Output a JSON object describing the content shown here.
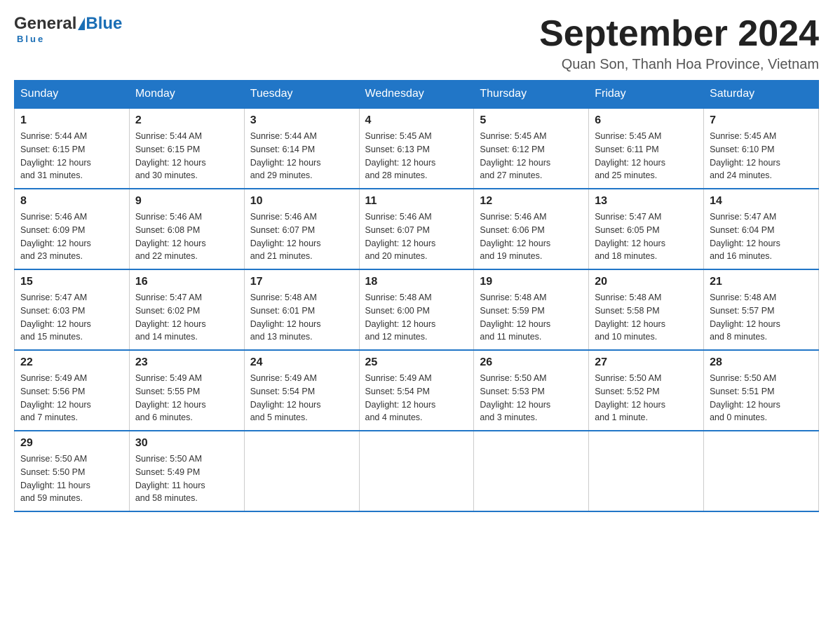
{
  "logo": {
    "general": "General",
    "blue": "Blue"
  },
  "title": "September 2024",
  "location": "Quan Son, Thanh Hoa Province, Vietnam",
  "days_of_week": [
    "Sunday",
    "Monday",
    "Tuesday",
    "Wednesday",
    "Thursday",
    "Friday",
    "Saturday"
  ],
  "weeks": [
    [
      {
        "day": "1",
        "sunrise": "5:44 AM",
        "sunset": "6:15 PM",
        "daylight": "12 hours and 31 minutes."
      },
      {
        "day": "2",
        "sunrise": "5:44 AM",
        "sunset": "6:15 PM",
        "daylight": "12 hours and 30 minutes."
      },
      {
        "day": "3",
        "sunrise": "5:44 AM",
        "sunset": "6:14 PM",
        "daylight": "12 hours and 29 minutes."
      },
      {
        "day": "4",
        "sunrise": "5:45 AM",
        "sunset": "6:13 PM",
        "daylight": "12 hours and 28 minutes."
      },
      {
        "day": "5",
        "sunrise": "5:45 AM",
        "sunset": "6:12 PM",
        "daylight": "12 hours and 27 minutes."
      },
      {
        "day": "6",
        "sunrise": "5:45 AM",
        "sunset": "6:11 PM",
        "daylight": "12 hours and 25 minutes."
      },
      {
        "day": "7",
        "sunrise": "5:45 AM",
        "sunset": "6:10 PM",
        "daylight": "12 hours and 24 minutes."
      }
    ],
    [
      {
        "day": "8",
        "sunrise": "5:46 AM",
        "sunset": "6:09 PM",
        "daylight": "12 hours and 23 minutes."
      },
      {
        "day": "9",
        "sunrise": "5:46 AM",
        "sunset": "6:08 PM",
        "daylight": "12 hours and 22 minutes."
      },
      {
        "day": "10",
        "sunrise": "5:46 AM",
        "sunset": "6:07 PM",
        "daylight": "12 hours and 21 minutes."
      },
      {
        "day": "11",
        "sunrise": "5:46 AM",
        "sunset": "6:07 PM",
        "daylight": "12 hours and 20 minutes."
      },
      {
        "day": "12",
        "sunrise": "5:46 AM",
        "sunset": "6:06 PM",
        "daylight": "12 hours and 19 minutes."
      },
      {
        "day": "13",
        "sunrise": "5:47 AM",
        "sunset": "6:05 PM",
        "daylight": "12 hours and 18 minutes."
      },
      {
        "day": "14",
        "sunrise": "5:47 AM",
        "sunset": "6:04 PM",
        "daylight": "12 hours and 16 minutes."
      }
    ],
    [
      {
        "day": "15",
        "sunrise": "5:47 AM",
        "sunset": "6:03 PM",
        "daylight": "12 hours and 15 minutes."
      },
      {
        "day": "16",
        "sunrise": "5:47 AM",
        "sunset": "6:02 PM",
        "daylight": "12 hours and 14 minutes."
      },
      {
        "day": "17",
        "sunrise": "5:48 AM",
        "sunset": "6:01 PM",
        "daylight": "12 hours and 13 minutes."
      },
      {
        "day": "18",
        "sunrise": "5:48 AM",
        "sunset": "6:00 PM",
        "daylight": "12 hours and 12 minutes."
      },
      {
        "day": "19",
        "sunrise": "5:48 AM",
        "sunset": "5:59 PM",
        "daylight": "12 hours and 11 minutes."
      },
      {
        "day": "20",
        "sunrise": "5:48 AM",
        "sunset": "5:58 PM",
        "daylight": "12 hours and 10 minutes."
      },
      {
        "day": "21",
        "sunrise": "5:48 AM",
        "sunset": "5:57 PM",
        "daylight": "12 hours and 8 minutes."
      }
    ],
    [
      {
        "day": "22",
        "sunrise": "5:49 AM",
        "sunset": "5:56 PM",
        "daylight": "12 hours and 7 minutes."
      },
      {
        "day": "23",
        "sunrise": "5:49 AM",
        "sunset": "5:55 PM",
        "daylight": "12 hours and 6 minutes."
      },
      {
        "day": "24",
        "sunrise": "5:49 AM",
        "sunset": "5:54 PM",
        "daylight": "12 hours and 5 minutes."
      },
      {
        "day": "25",
        "sunrise": "5:49 AM",
        "sunset": "5:54 PM",
        "daylight": "12 hours and 4 minutes."
      },
      {
        "day": "26",
        "sunrise": "5:50 AM",
        "sunset": "5:53 PM",
        "daylight": "12 hours and 3 minutes."
      },
      {
        "day": "27",
        "sunrise": "5:50 AM",
        "sunset": "5:52 PM",
        "daylight": "12 hours and 1 minute."
      },
      {
        "day": "28",
        "sunrise": "5:50 AM",
        "sunset": "5:51 PM",
        "daylight": "12 hours and 0 minutes."
      }
    ],
    [
      {
        "day": "29",
        "sunrise": "5:50 AM",
        "sunset": "5:50 PM",
        "daylight": "11 hours and 59 minutes."
      },
      {
        "day": "30",
        "sunrise": "5:50 AM",
        "sunset": "5:49 PM",
        "daylight": "11 hours and 58 minutes."
      },
      null,
      null,
      null,
      null,
      null
    ]
  ],
  "labels": {
    "sunrise": "Sunrise: ",
    "sunset": "Sunset: ",
    "daylight": "Daylight: "
  }
}
